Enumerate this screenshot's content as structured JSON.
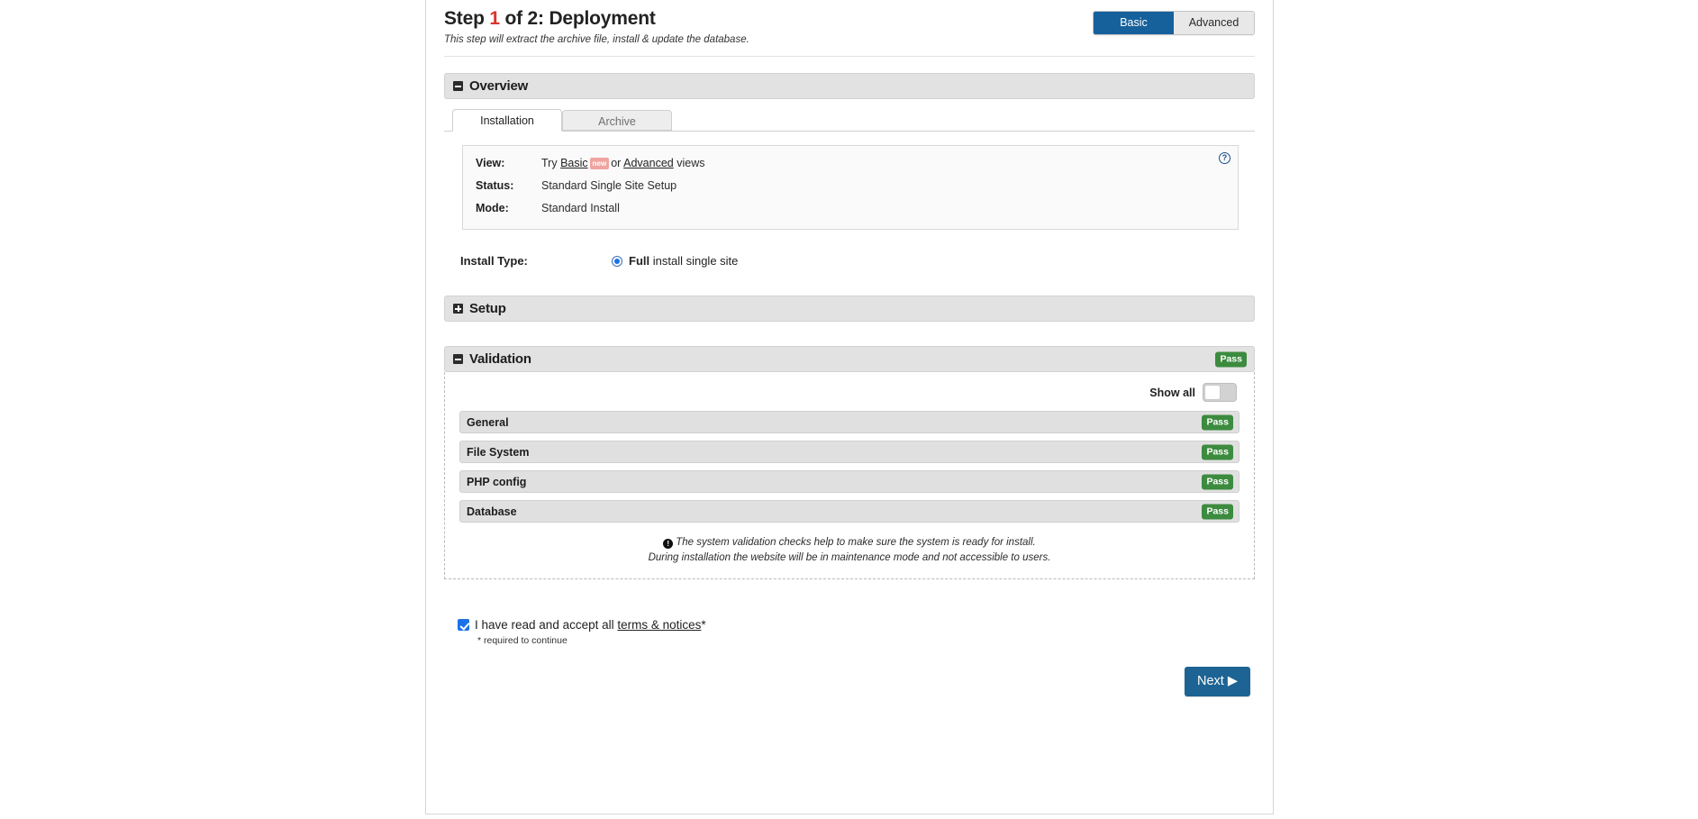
{
  "header": {
    "title_prefix": "Step",
    "step_number": "1",
    "title_suffix": "of 2: Deployment",
    "subtitle": "This step will extract the archive file, install & update the database.",
    "view_switch": {
      "basic_label": "Basic",
      "advanced_label": "Advanced",
      "active": "Basic"
    }
  },
  "overview": {
    "section_title": "Overview",
    "tabs": [
      {
        "label": "Installation",
        "active": true
      },
      {
        "label": "Archive",
        "active": false
      }
    ],
    "help_icon": "question-mark-icon",
    "info_rows": [
      {
        "label": "View:",
        "prefix": "Try",
        "link1": "Basic",
        "badge": "new",
        "middle": "or",
        "link2": "Advanced",
        "suffix": "views"
      },
      {
        "label": "Status:",
        "value": "Standard Single Site Setup"
      },
      {
        "label": "Mode:",
        "value": "Standard Install"
      }
    ],
    "install_type": {
      "label": "Install Type:",
      "option_bold": "Full",
      "option_rest": "install single site",
      "selected": true
    }
  },
  "setup": {
    "section_title": "Setup",
    "collapsed": true
  },
  "validation": {
    "section_title": "Validation",
    "status_badge": "Pass",
    "show_all_label": "Show all",
    "show_all_on": false,
    "checks": [
      {
        "name": "General",
        "status": "Pass"
      },
      {
        "name": "File System",
        "status": "Pass"
      },
      {
        "name": "PHP config",
        "status": "Pass"
      },
      {
        "name": "Database",
        "status": "Pass"
      }
    ],
    "note_line1": "The system validation checks help to make sure the system is ready for install.",
    "note_line2": "During installation the website will be in maintenance mode and not accessible to users."
  },
  "terms": {
    "checked": true,
    "text_before": "I have read and accept all",
    "link": "terms & notices",
    "asterisk": "*",
    "required_note": "* required to continue"
  },
  "footer": {
    "next_label": "Next",
    "next_arrow": "▶"
  },
  "colors": {
    "accent_blue": "#16619c",
    "next_blue": "#1d6494",
    "pass_green": "#3c8b3f",
    "new_badge_pink": "#efa4a0",
    "step_red": "#d9342b"
  }
}
